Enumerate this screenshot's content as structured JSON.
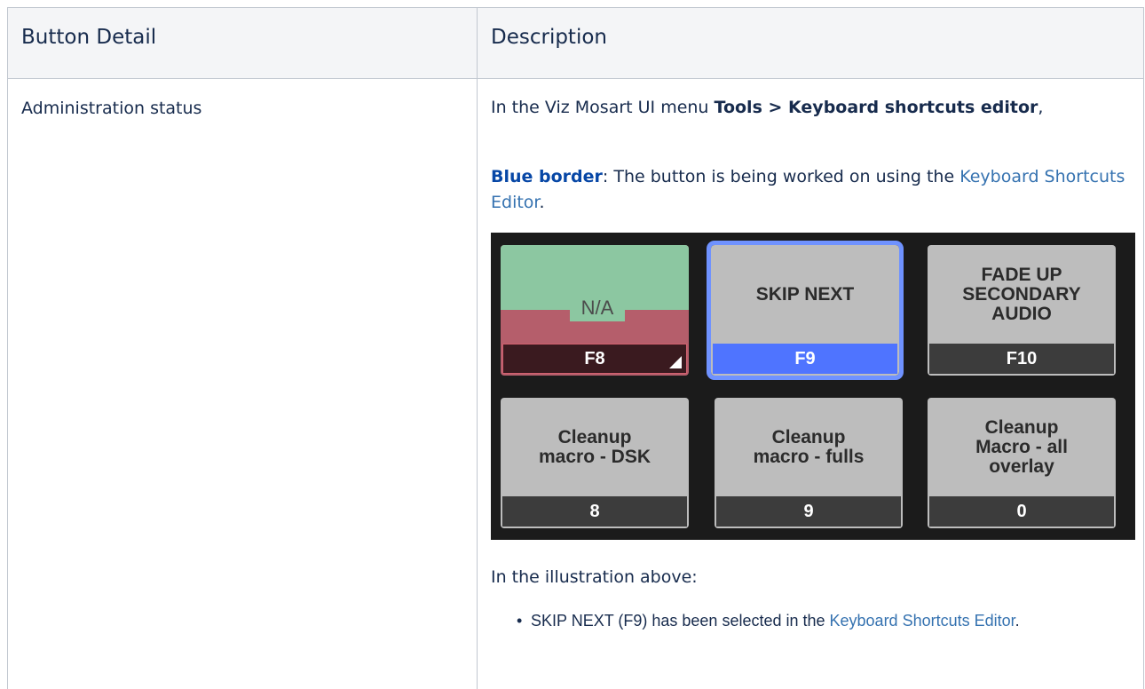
{
  "table": {
    "header": {
      "col1": "Button Detail",
      "col2": "Description"
    },
    "row": {
      "label": "Administration status",
      "p1_prefix": "In the Viz Mosart UI menu ",
      "p1_menu": "Tools > Keyboard shortcuts editor",
      "p1_suffix": ",",
      "p2_bold": "Blue border",
      "p2_text": ": The button is being worked on using the ",
      "p2_link": "Keyboard Shortcuts Editor",
      "p2_end": ".",
      "p3": "In the illustration above:",
      "bullet": "•",
      "bullet_text": "SKIP NEXT (F9) has been selected in the ",
      "bullet_link": "Keyboard Shortcuts Editor",
      "bullet_end": "."
    }
  },
  "illustration": {
    "buttons": [
      {
        "label": "N/A",
        "key": "F8",
        "state": "na"
      },
      {
        "label": "SKIP NEXT",
        "key": "F9",
        "state": "selected"
      },
      {
        "label": "FADE UP SECONDARY AUDIO",
        "key": "F10",
        "state": "normal"
      },
      {
        "label": "Cleanup macro - DSK",
        "key": "8",
        "state": "normal"
      },
      {
        "label": "Cleanup macro - fulls",
        "key": "9",
        "state": "normal"
      },
      {
        "label": "Cleanup Macro - all overlay",
        "key": "0",
        "state": "normal"
      }
    ],
    "colors": {
      "background": "#1b1b1b",
      "button": "#bdbdbd",
      "selected_border": "#6f92ff",
      "selected_key_bar": "#4f74ff",
      "na_top": "#8cc7a1",
      "na_bottom": "#b55e6b"
    }
  }
}
